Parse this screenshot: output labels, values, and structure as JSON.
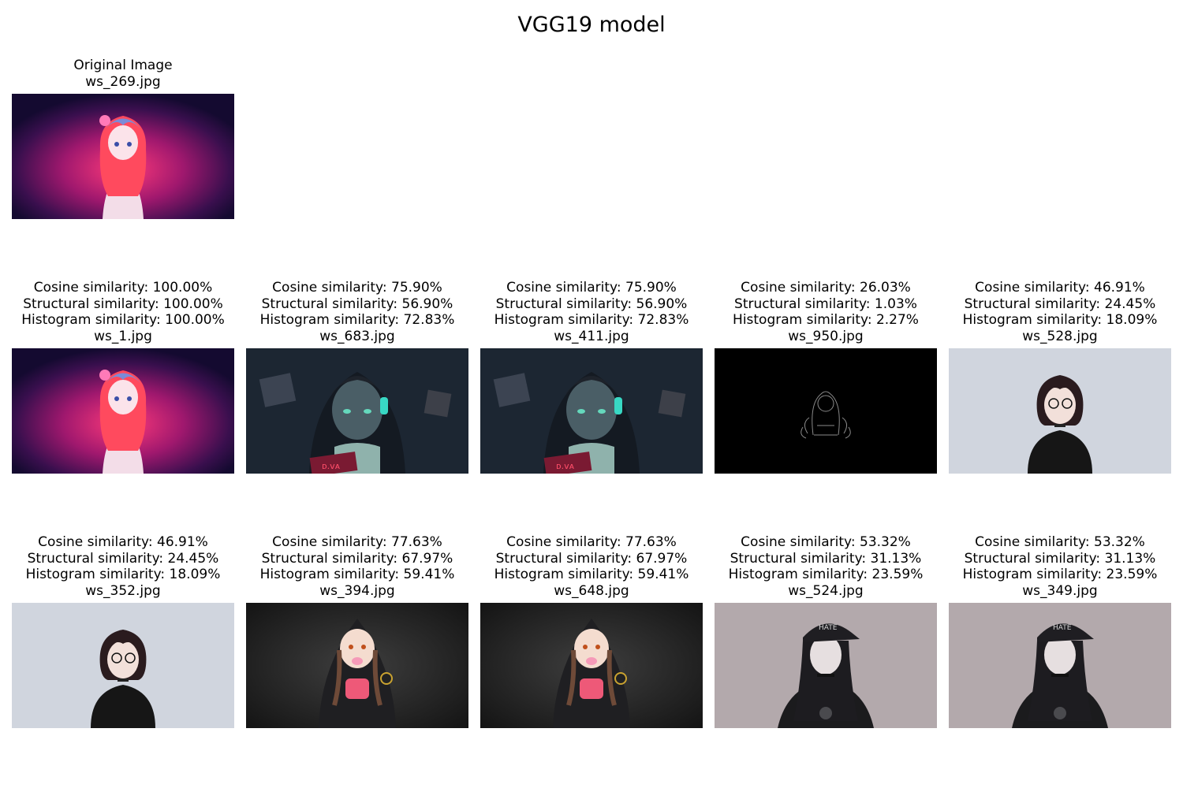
{
  "figure": {
    "title": "VGG19 model"
  },
  "original": {
    "heading": "Original Image",
    "filename": "ws_269.jpg",
    "scene": "pink-haired-girl"
  },
  "results": [
    {
      "cosine": "Cosine similarity: 100.00%",
      "structural": "Structural similarity: 100.00%",
      "histogram": "Histogram similarity: 100.00%",
      "filename": "ws_1.jpg",
      "scene": "pink-haired-girl"
    },
    {
      "cosine": "Cosine similarity: 75.90%",
      "structural": "Structural similarity: 56.90%",
      "histogram": "Histogram similarity: 72.83%",
      "filename": "ws_683.jpg",
      "scene": "headset-girl-dark-teal"
    },
    {
      "cosine": "Cosine similarity: 75.90%",
      "structural": "Structural similarity: 56.90%",
      "histogram": "Histogram similarity: 72.83%",
      "filename": "ws_411.jpg",
      "scene": "headset-girl-dark-teal"
    },
    {
      "cosine": "Cosine similarity: 26.03%",
      "structural": "Structural similarity: 1.03%",
      "histogram": "Histogram similarity: 2.27%",
      "filename": "ws_950.jpg",
      "scene": "outline-on-black"
    },
    {
      "cosine": "Cosine similarity: 46.91%",
      "structural": "Structural similarity: 24.45%",
      "histogram": "Histogram similarity: 18.09%",
      "filename": "ws_528.jpg",
      "scene": "glasses-girl-light"
    },
    {
      "cosine": "Cosine similarity: 46.91%",
      "structural": "Structural similarity: 24.45%",
      "histogram": "Histogram similarity: 18.09%",
      "filename": "ws_352.jpg",
      "scene": "glasses-girl-light"
    },
    {
      "cosine": "Cosine similarity: 77.63%",
      "structural": "Structural similarity: 67.97%",
      "histogram": "Histogram similarity: 59.41%",
      "filename": "ws_394.jpg",
      "scene": "hoodie-girl-dark"
    },
    {
      "cosine": "Cosine similarity: 77.63%",
      "structural": "Structural similarity: 67.97%",
      "histogram": "Histogram similarity: 59.41%",
      "filename": "ws_648.jpg",
      "scene": "hoodie-girl-dark"
    },
    {
      "cosine": "Cosine similarity: 53.32%",
      "structural": "Structural similarity: 31.13%",
      "histogram": "Histogram similarity: 23.59%",
      "filename": "ws_524.jpg",
      "scene": "cap-girl-grey"
    },
    {
      "cosine": "Cosine similarity: 53.32%",
      "structural": "Structural similarity: 31.13%",
      "histogram": "Histogram similarity: 23.59%",
      "filename": "ws_349.jpg",
      "scene": "cap-girl-grey"
    }
  ]
}
